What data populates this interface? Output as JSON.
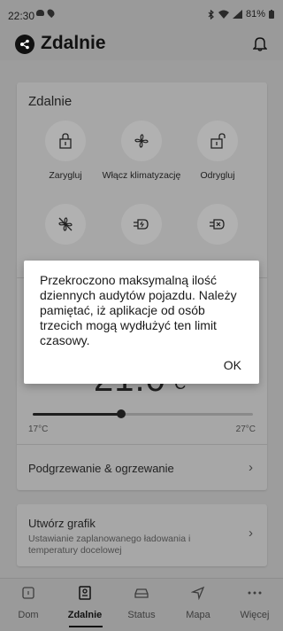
{
  "status_bar": {
    "time": "22:30",
    "battery": "81%"
  },
  "app_bar": {
    "title": "Zdalnie"
  },
  "remote_card": {
    "title": "Zdalnie",
    "actions": [
      {
        "label": "Zarygluj",
        "icon": "lock-icon"
      },
      {
        "label": "Włącz klimatyzację",
        "icon": "fan-icon"
      },
      {
        "label": "Odrygluj",
        "icon": "unlock-icon"
      },
      {
        "label": "",
        "icon": "fan-off-icon"
      },
      {
        "label": "",
        "icon": "charge-plug-icon"
      },
      {
        "label": "",
        "icon": "charge-stop-icon"
      }
    ],
    "temperature": {
      "value": "21.0",
      "unit": "°C",
      "min_label": "17°C",
      "max_label": "27°C",
      "level": 0.4
    },
    "heating_row": "Podgrzewanie & ogrzewanie"
  },
  "schedule_card": {
    "title": "Utwórz grafik",
    "subtitle": "Ustawianie zaplanowanego ładowania i temperatury docelowej"
  },
  "bottom_nav": [
    {
      "label": "Dom",
      "icon": "home-icon",
      "active": false
    },
    {
      "label": "Zdalnie",
      "icon": "remote-icon",
      "active": true
    },
    {
      "label": "Status",
      "icon": "car-icon",
      "active": false
    },
    {
      "label": "Mapa",
      "icon": "navigation-icon",
      "active": false
    },
    {
      "label": "Więcej",
      "icon": "more-icon",
      "active": false
    }
  ],
  "dialog": {
    "message": "Przekroczono maksymalną ilość dziennych audytów pojazdu. Należy pamiętać, iż aplikacje od osób trzecich mogą wydłużyć ten limit czasowy.",
    "ok_label": "OK"
  }
}
